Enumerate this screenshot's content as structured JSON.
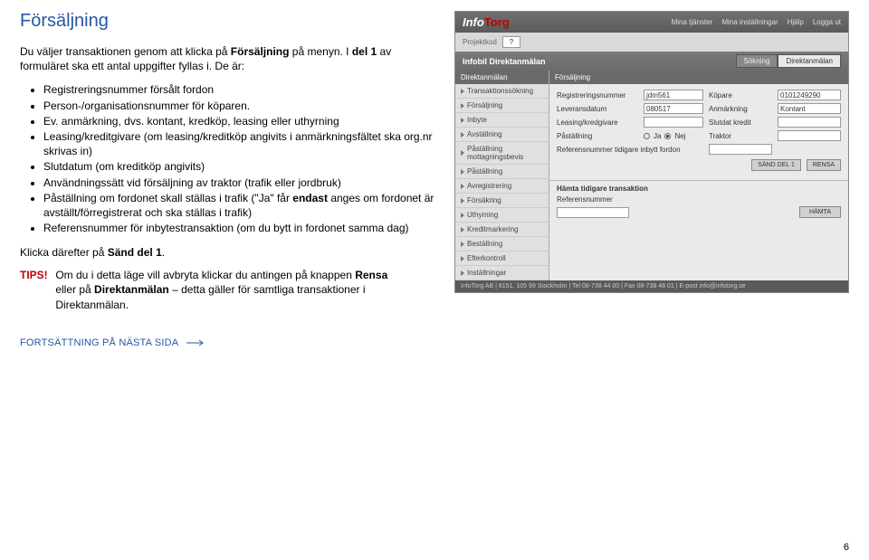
{
  "page": {
    "title": "Försäljning",
    "intro_pre": "Du väljer transaktionen genom att klicka på ",
    "intro_bold1": "Försäljning",
    "intro_mid": " på menyn.\nI ",
    "intro_bold2": "del 1",
    "intro_post": " av formuläret ska ett antal uppgifter fyllas i. De är:",
    "bullets": [
      "Registreringsnummer försålt fordon",
      "Person-/organisationsnummer för köparen.",
      "Ev. anmärkning, dvs. kontant, kredköp, leasing eller uthyrning",
      "Leasing/kreditgivare (om leasing/kreditköp angivits i anmärkningsfältet ska org.nr skrivas in)",
      "Slutdatum (om kreditköp angivits)",
      "Användningssätt vid försäljning av traktor (trafik eller jordbruk)",
      "Påställning om fordonet skall ställas i trafik (\"Ja\" får endast anges om fordonet är avställt/förregistrerat och ska ställas i trafik)",
      "Referensnummer för inbytestransaktion (om du bytt in fordonet samma dag)"
    ],
    "after": "Klicka därefter på Sänd del 1.",
    "tips_label": "TIPS!",
    "tips_body_pre": "Om du i detta läge vill avbryta klickar du antingen på knappen ",
    "tips_bold1": "Rensa",
    "tips_mid": " eller på ",
    "tips_bold2": "Direktanmälan",
    "tips_post": " – detta gäller för samtliga transaktioner i Direktanmälan.",
    "continue": "FORTSÄTTNING PÅ NÄSTA SIDA",
    "pagenum": "6"
  },
  "app": {
    "brand_info": "Info",
    "brand_torg": "Torg",
    "nav": [
      "Mina tjänster",
      "Mina inställningar",
      "Hjälp",
      "Logga ut"
    ],
    "proj_label": "Projektkod",
    "proj_value": "?",
    "sub_title": "Infobil Direktanmälan",
    "tab1": "Sökning",
    "tab2": "Direktanmälan",
    "side_head": "Direktanmälan",
    "side_items": [
      "Transaktionssökning",
      "Försäljning",
      "Inbyte",
      "Avställning",
      "Påställning mottagningsbevis",
      "Påställning",
      "Avregistrering",
      "Försäkring",
      "Uthyrning",
      "Kreditmarkering",
      "Beställning",
      "Efterkontroll",
      "Inställningar"
    ],
    "content_head": "Försäljning",
    "form": {
      "regnr_label": "Registreringsnummer",
      "regnr_value": "jdm561",
      "kopare_label": "Köpare",
      "kopare_value": "0101249290",
      "leveransdatum_label": "Leveransdatum",
      "leveransdatum_value": "080517",
      "anmarkning_label": "Anmärkning",
      "anmarkning_value": "Kontant",
      "leasing_label": "Leasing/kredgivare",
      "slutdat_label": "Slutdat kredit",
      "pastallning_label": "Påställning",
      "ja": "Ja",
      "nej": "Nej",
      "traktor_label": "Traktor",
      "refnr_label": "Referensnummer tidigare inbytt fordon",
      "btn_send": "SÄND DEL 1",
      "btn_clear": "RENSA"
    },
    "sec2": {
      "title": "Hämta tidigare transaktion",
      "refnr_label": "Referensnummer",
      "btn": "HÄMTA"
    },
    "footer": "InfoTorg AB | 6151, 105 99 Stockholm | Tel 08-738 44 00 | Fax 08-738 48 01 | E-post info@infotorg.se"
  }
}
